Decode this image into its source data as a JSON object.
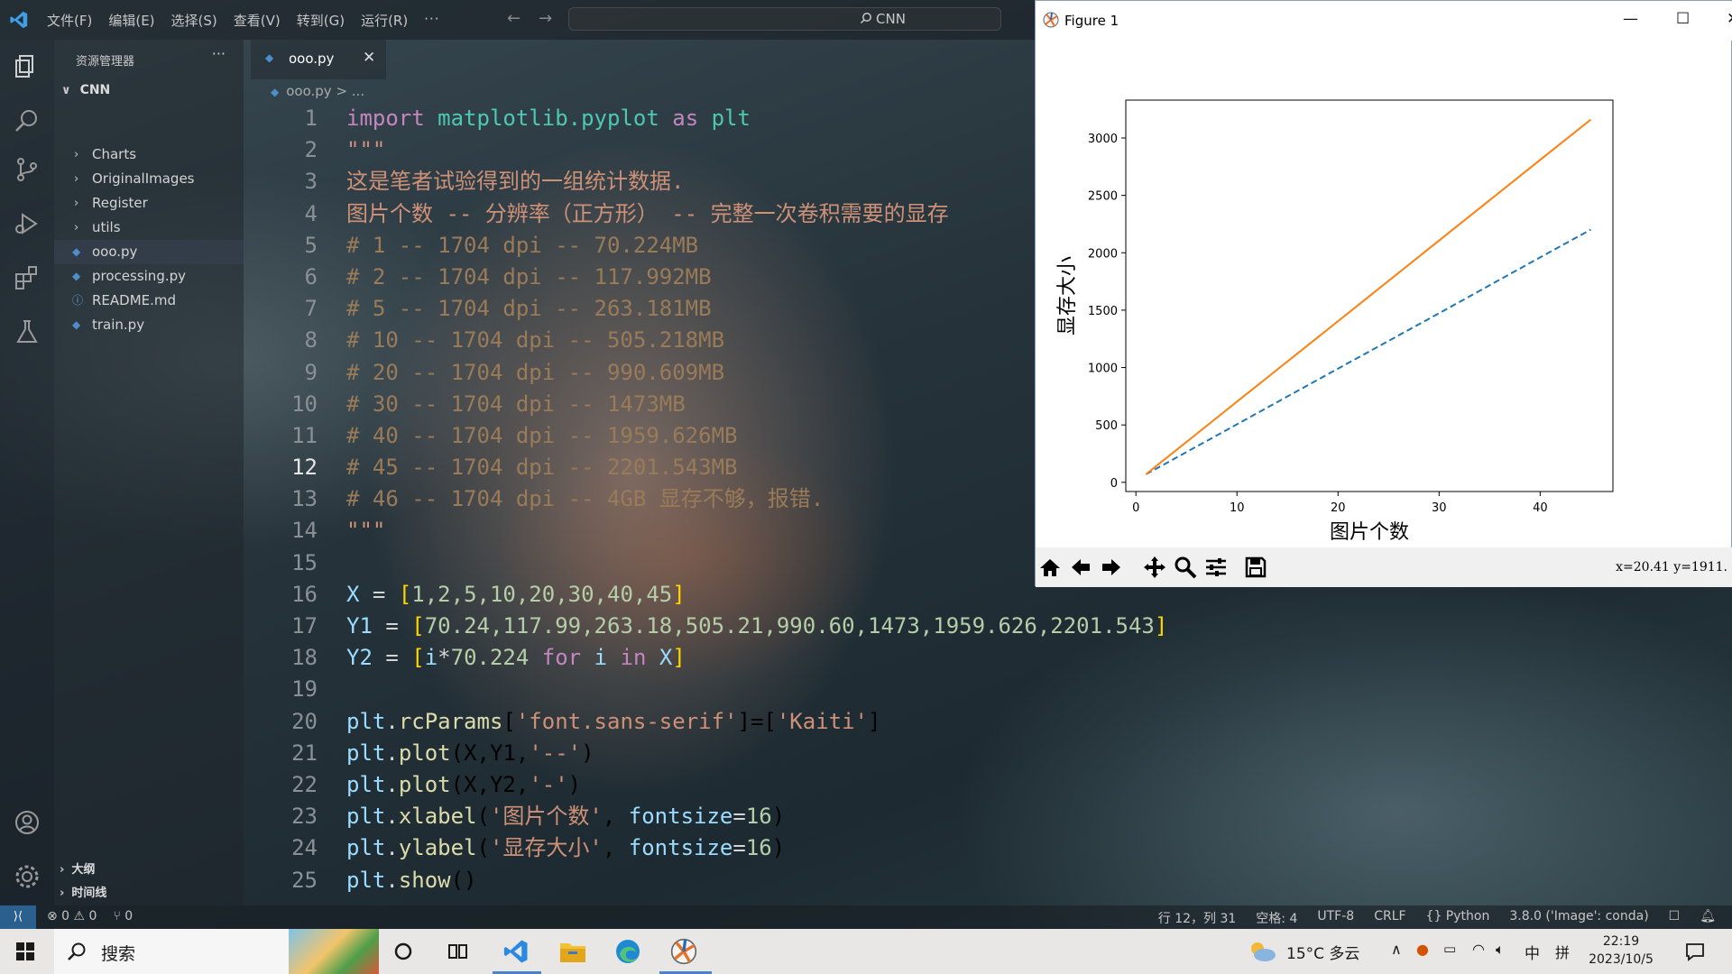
{
  "vscode": {
    "menu": [
      "文件(F)",
      "编辑(E)",
      "选择(S)",
      "查看(V)",
      "转到(G)",
      "运行(R)",
      "···"
    ],
    "search_text": "CNN",
    "sidebar": {
      "header": "资源管理器",
      "more": "···",
      "root": "CNN",
      "items": [
        {
          "label": "Charts",
          "kind": "folder"
        },
        {
          "label": "OriginalImages",
          "kind": "folder"
        },
        {
          "label": "Register",
          "kind": "folder"
        },
        {
          "label": "utils",
          "kind": "folder"
        },
        {
          "label": "ooo.py",
          "kind": "python-file",
          "selected": true
        },
        {
          "label": "processing.py",
          "kind": "python-file"
        },
        {
          "label": "README.md",
          "kind": "info-file"
        },
        {
          "label": "train.py",
          "kind": "python-file"
        }
      ],
      "outline": "大纲",
      "timeline": "时间线"
    },
    "tab": {
      "name": "ooo.py",
      "close": "✕"
    },
    "breadcrumb": {
      "file": "ooo.py",
      "sep": "> ..."
    },
    "code_lines": [
      "import matplotlib.pyplot as plt",
      "\"\"\"",
      "这是笔者试验得到的一组统计数据.",
      "图片个数 -- 分辨率（正方形） -- 完整一次卷积需要的显存",
      "# 1 -- 1704 dpi -- 70.224MB",
      "# 2 -- 1704 dpi -- 117.992MB",
      "# 5 -- 1704 dpi -- 263.181MB",
      "# 10 -- 1704 dpi -- 505.218MB",
      "# 20 -- 1704 dpi -- 990.609MB",
      "# 30 -- 1704 dpi -- 1473MB",
      "# 40 -- 1704 dpi -- 1959.626MB",
      "# 45 -- 1704 dpi -- 2201.543MB",
      "# 46 -- 1704 dpi -- 4GB 显存不够，报错.",
      "\"\"\"",
      "",
      "X = [1,2,5,10,20,30,40,45]",
      "Y1 = [70.24,117.99,263.18,505.21,990.60,1473,1959.626,2201.543]",
      "Y2 = [i*70.224 for i in X]",
      "",
      "plt.rcParams['font.sans-serif']=['Kaiti']",
      "plt.plot(X,Y1,'--')",
      "plt.plot(X,Y2,'-')",
      "plt.xlabel('图片个数', fontsize=16)",
      "plt.ylabel('显存大小', fontsize=16)",
      "plt.show()"
    ],
    "current_line": 12,
    "status": {
      "left": [
        "⊗ 0 ⚠ 0",
        "⑂ 0"
      ],
      "right": [
        "行 12，列 31",
        "空格: 4",
        "UTF-8",
        "CRLF",
        "{} Python",
        "3.8.0 ('Image': conda)"
      ]
    }
  },
  "figure": {
    "title": "Figure 1",
    "coords": "x=20.41  y=1911.",
    "colors": {
      "series1": "#1f77b4",
      "series2": "#ff7f0e"
    }
  },
  "chart_data": {
    "type": "line",
    "xlabel": "图片个数",
    "ylabel": "显存大小",
    "xlim": [
      -1,
      47.2
    ],
    "ylim": [
      -80,
      3330
    ],
    "xticks": [
      0,
      10,
      20,
      30,
      40
    ],
    "yticks": [
      0,
      500,
      1000,
      1500,
      2000,
      2500,
      3000
    ],
    "series": [
      {
        "style": "--",
        "color": "#1f77b4",
        "x": [
          1,
          2,
          5,
          10,
          20,
          30,
          40,
          45
        ],
        "y": [
          70.24,
          117.99,
          263.18,
          505.21,
          990.6,
          1473,
          1959.626,
          2201.543
        ]
      },
      {
        "style": "-",
        "color": "#ff7f0e",
        "x": [
          1,
          2,
          5,
          10,
          20,
          30,
          40,
          45
        ],
        "y": [
          70.224,
          140.448,
          351.12,
          702.24,
          1404.48,
          2106.72,
          2808.96,
          3160.08
        ]
      }
    ]
  },
  "taskbar": {
    "search_label": "搜索",
    "weather": "15°C 多云",
    "ime": "中",
    "time": "22:19",
    "date": "2023/10/5"
  }
}
